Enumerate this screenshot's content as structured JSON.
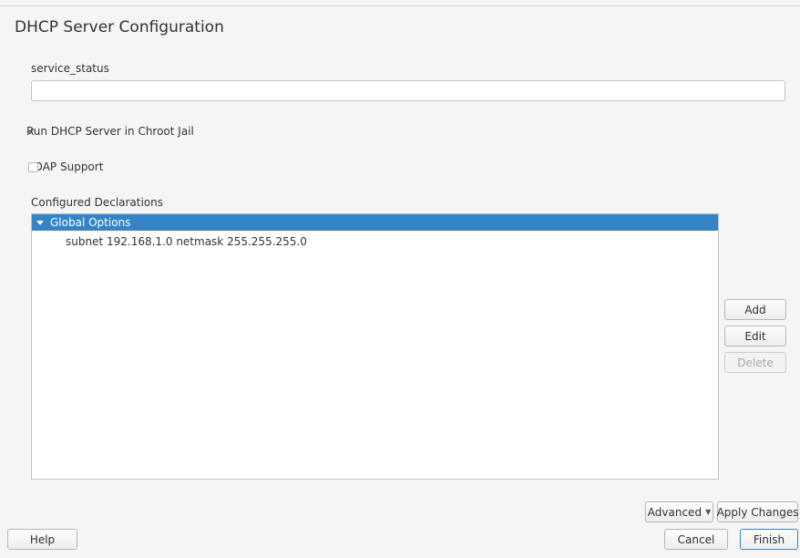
{
  "window": {
    "title": "DHCP Server Configuration"
  },
  "service": {
    "label": "service_status",
    "value": ""
  },
  "options": {
    "chroot": {
      "label": "Run DHCP Server in Chroot Jail",
      "checked": true,
      "mark": "✓"
    },
    "ldap": {
      "label": "LDAP Support",
      "checked": false
    }
  },
  "declarations": {
    "label": "Configured Declarations",
    "items": [
      {
        "label": "Global Options",
        "selected": true,
        "expanded": true
      },
      {
        "label": "subnet 192.168.1.0 netmask 255.255.255.0"
      }
    ]
  },
  "side_buttons": {
    "add": "Add",
    "edit": "Edit",
    "delete": "Delete"
  },
  "footer": {
    "advanced": "Advanced",
    "apply": "Apply Changes",
    "help": "Help",
    "cancel": "Cancel",
    "finish": "Finish"
  },
  "colors": {
    "selection": "#3584c6",
    "background": "#f6f5f4"
  }
}
